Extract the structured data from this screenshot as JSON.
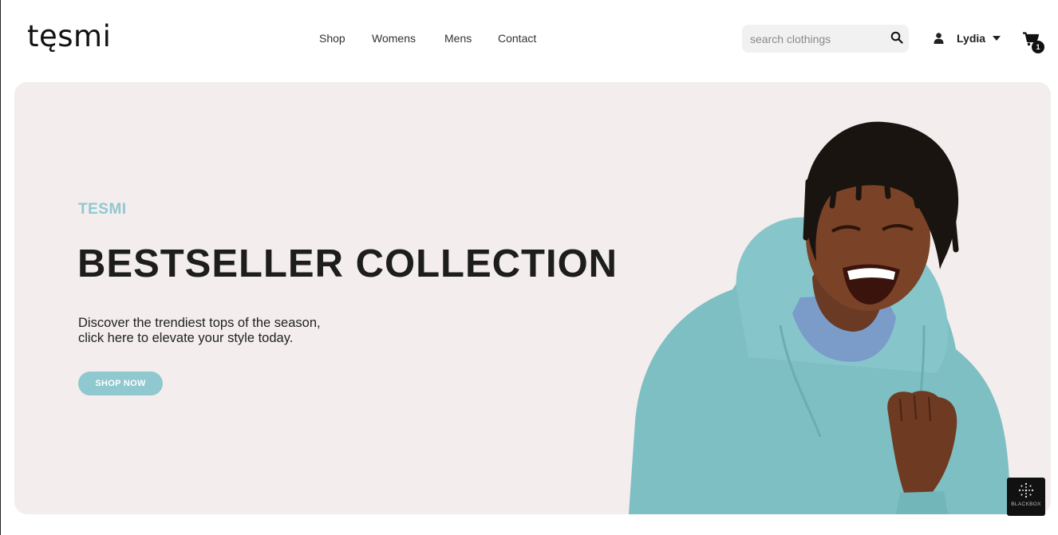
{
  "brand": {
    "logo_text": "tęsmi"
  },
  "nav": {
    "items": [
      "Shop",
      "Womens",
      "Mens",
      "Contact"
    ]
  },
  "search": {
    "placeholder": "search clothings",
    "icon": "search-icon"
  },
  "user": {
    "name": "Lydia",
    "icon": "user-icon"
  },
  "cart": {
    "count": "1",
    "icon": "cart-icon"
  },
  "hero": {
    "eyebrow": "TESMI",
    "headline": "BESTSELLER COLLECTION",
    "description_line1": "Discover the trendiest tops of the season,",
    "description_line2": "click here to elevate your style today.",
    "cta_label": "SHOP NOW",
    "image_subject": "smiling man in teal hoodie"
  },
  "widget": {
    "label": "BLACKBOX"
  },
  "colors": {
    "accent": "#8fc8cf",
    "hero_bg": "#f3eded",
    "text_dark": "#1d1d1d",
    "hoodie": "#7ebfc3"
  }
}
